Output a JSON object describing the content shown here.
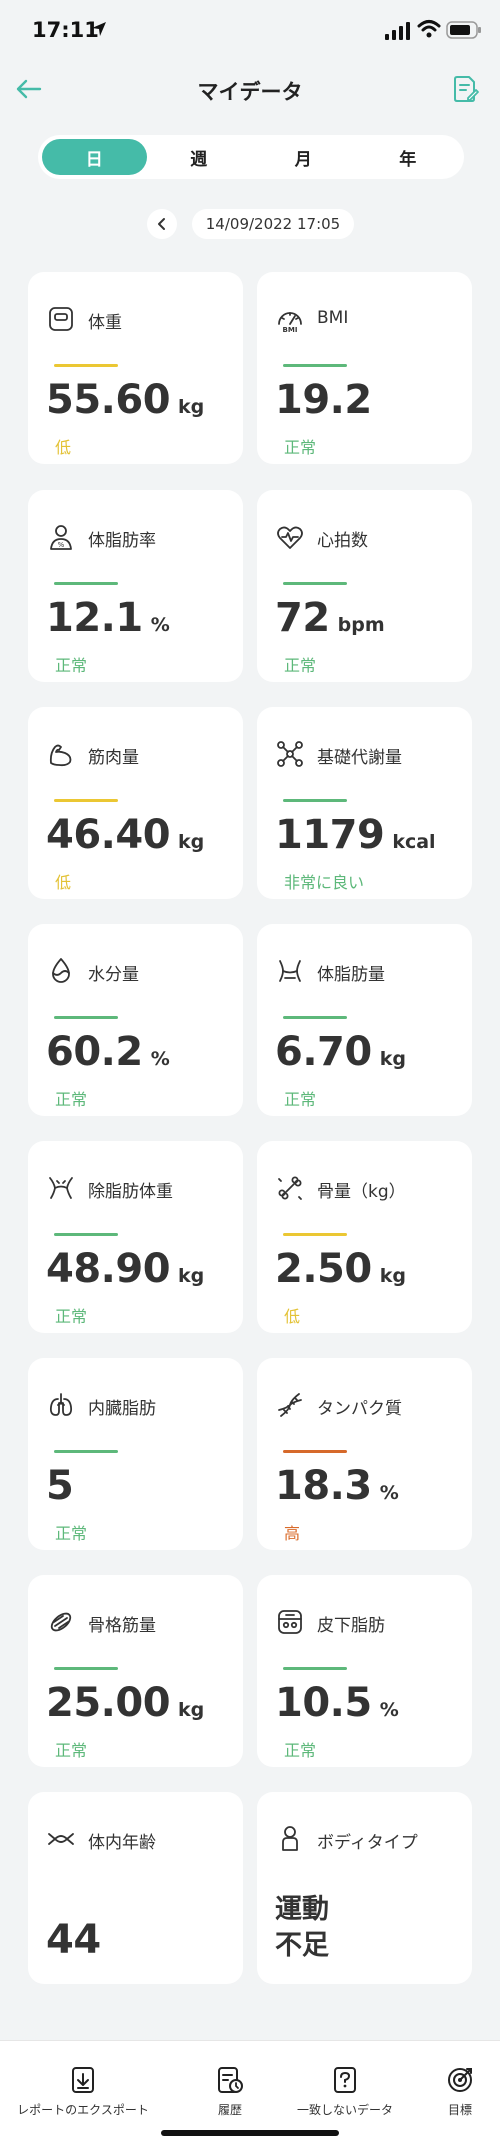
{
  "status_bar": {
    "time": "17:11"
  },
  "header": {
    "title": "マイデータ"
  },
  "period_tabs": [
    {
      "label": "日",
      "active": true
    },
    {
      "label": "週",
      "active": false
    },
    {
      "label": "月",
      "active": false
    },
    {
      "label": "年",
      "active": false
    }
  ],
  "date": {
    "label": "14/09/2022 17:05"
  },
  "colors": {
    "accent": "#45bba8",
    "normal": "#5db87a",
    "low": "#e3c235",
    "high": "#d96b2b",
    "bar_green": "#5db87a",
    "bar_yellow": "#ebc733",
    "bar_orange": "#d6692a"
  },
  "metrics": [
    {
      "label": "体重",
      "value": "55.60",
      "unit": "kg",
      "status": "低",
      "level": "low",
      "icon": "scale-icon"
    },
    {
      "label": "BMI",
      "value": "19.2",
      "unit": "",
      "status": "正常",
      "level": "normal",
      "icon": "bmi-gauge-icon"
    },
    {
      "label": "体脂肪率",
      "value": "12.1",
      "unit": "%",
      "status": "正常",
      "level": "normal",
      "icon": "body-fat-icon"
    },
    {
      "label": "心拍数",
      "value": "72",
      "unit": "bpm",
      "status": "正常",
      "level": "normal",
      "icon": "heart-rate-icon"
    },
    {
      "label": "筋肉量",
      "value": "46.40",
      "unit": "kg",
      "status": "低",
      "level": "low",
      "icon": "muscle-icon"
    },
    {
      "label": "基礎代謝量",
      "value": "1179",
      "unit": "kcal",
      "status": "非常に良い",
      "level": "normal",
      "icon": "metabolism-icon"
    },
    {
      "label": "水分量",
      "value": "60.2",
      "unit": "%",
      "status": "正常",
      "level": "normal",
      "icon": "water-drop-icon"
    },
    {
      "label": "体脂肪量",
      "value": "6.70",
      "unit": "kg",
      "status": "正常",
      "level": "normal",
      "icon": "waist-icon"
    },
    {
      "label": "除脂肪体重",
      "value": "48.90",
      "unit": "kg",
      "status": "正常",
      "level": "normal",
      "icon": "lean-body-icon"
    },
    {
      "label": "骨量（kg）",
      "value": "2.50",
      "unit": "kg",
      "status": "低",
      "level": "low",
      "icon": "bone-icon"
    },
    {
      "label": "内臓脂肪",
      "value": "5",
      "unit": "",
      "status": "正常",
      "level": "normal",
      "icon": "lungs-icon"
    },
    {
      "label": "タンパク質",
      "value": "18.3",
      "unit": "%",
      "status": "高",
      "level": "high",
      "icon": "dna-icon"
    },
    {
      "label": "骨格筋量",
      "value": "25.00",
      "unit": "kg",
      "status": "正常",
      "level": "normal",
      "icon": "skeletal-muscle-icon"
    },
    {
      "label": "皮下脂肪",
      "value": "10.5",
      "unit": "%",
      "status": "正常",
      "level": "normal",
      "icon": "subcutaneous-fat-icon"
    },
    {
      "label": "体内年齢",
      "value": "44",
      "unit": "",
      "status": "",
      "level": "",
      "icon": "body-age-icon"
    },
    {
      "label": "ボディタイプ",
      "value": "運動\n不足",
      "unit": "",
      "status": "",
      "level": "",
      "icon": "body-type-icon"
    }
  ],
  "bottom_nav": [
    {
      "label": "レポートのエクスポート",
      "icon": "export-report-icon"
    },
    {
      "label": "履歴",
      "icon": "history-icon"
    },
    {
      "label": "一致しないデータ",
      "icon": "unmatched-data-icon"
    },
    {
      "label": "目標",
      "icon": "target-icon"
    }
  ]
}
